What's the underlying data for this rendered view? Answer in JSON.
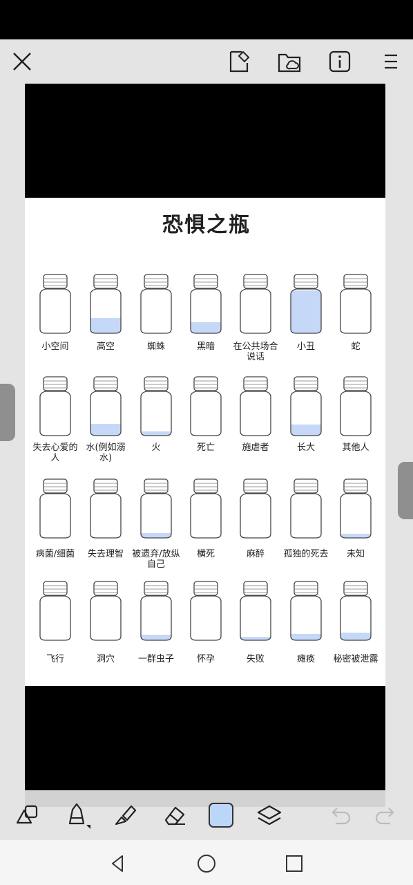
{
  "sheet": {
    "title": "恐惧之瓶",
    "jar_fill_color": "#c5d8f7",
    "jars": [
      {
        "label": "小空间",
        "fill": 0
      },
      {
        "label": "高空",
        "fill": 0.35
      },
      {
        "label": "蜘蛛",
        "fill": 0
      },
      {
        "label": "黑暗",
        "fill": 0.25
      },
      {
        "label": "在公共场合说话",
        "fill": 0
      },
      {
        "label": "小丑",
        "fill": 1
      },
      {
        "label": "蛇",
        "fill": 0
      },
      {
        "label": "失去心爱的人",
        "fill": 0
      },
      {
        "label": "水(例如溺水)",
        "fill": 0.28
      },
      {
        "label": "火",
        "fill": 0.1
      },
      {
        "label": "死亡",
        "fill": 0
      },
      {
        "label": "施虐者",
        "fill": 0
      },
      {
        "label": "长大",
        "fill": 0.25
      },
      {
        "label": "其他人",
        "fill": 0
      },
      {
        "label": "病菌/细菌",
        "fill": 0
      },
      {
        "label": "失去理智",
        "fill": 0
      },
      {
        "label": "被遗弃/放纵自己",
        "fill": 0.12
      },
      {
        "label": "横死",
        "fill": 0
      },
      {
        "label": "麻醉",
        "fill": 0
      },
      {
        "label": "孤独的死去",
        "fill": 0
      },
      {
        "label": "未知",
        "fill": 0.1
      },
      {
        "label": "飞行",
        "fill": 0
      },
      {
        "label": "洞穴",
        "fill": 0
      },
      {
        "label": "一群虫子",
        "fill": 0.13
      },
      {
        "label": "怀孕",
        "fill": 0
      },
      {
        "label": "失败",
        "fill": 0.08
      },
      {
        "label": "瘫痪",
        "fill": 0.15
      },
      {
        "label": "秘密被泄露",
        "fill": 0.18
      }
    ]
  },
  "toolbar": {
    "selected_color": "#bcd6f7"
  },
  "icons": {
    "close": "close-icon",
    "crop": "crop-save-icon",
    "cloud_folder": "cloud-folder-icon",
    "info": "info-icon",
    "menu": "menu-icon"
  }
}
